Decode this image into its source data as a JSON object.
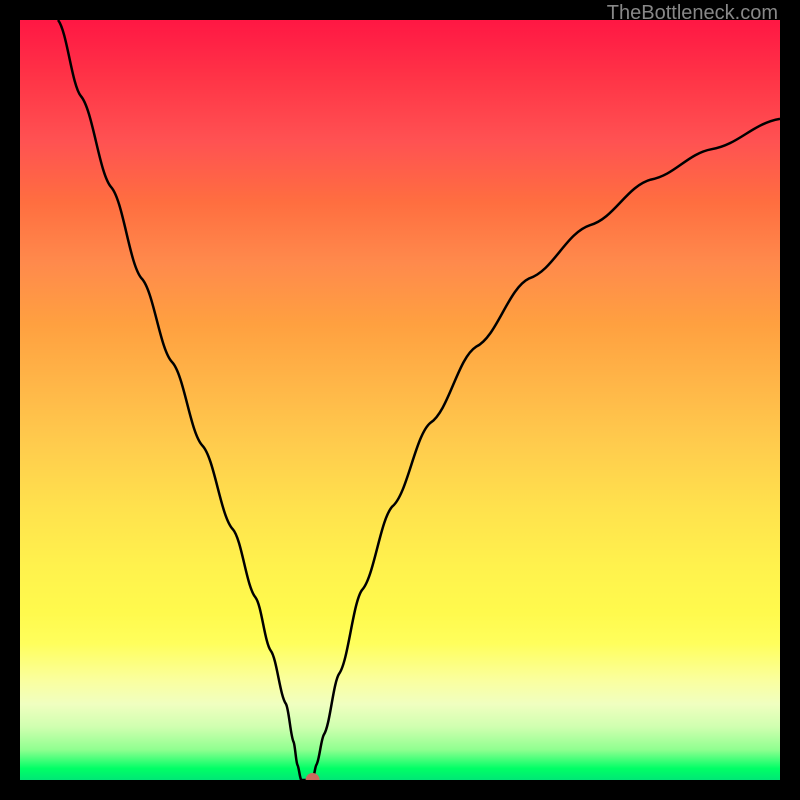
{
  "attribution": "TheBottleneck.com",
  "chart_data": {
    "type": "line",
    "title": "",
    "xlabel": "",
    "ylabel": "",
    "x_range": [
      0,
      100
    ],
    "y_range": [
      0,
      100
    ],
    "grid": false,
    "background": "rainbow-gradient-vertical",
    "gradient_colors": {
      "top": "#ff1744",
      "middle": "#ffeb3b",
      "bottom": "#00e676"
    },
    "series": [
      {
        "name": "bottleneck-curve",
        "color": "#000000",
        "stroke_width": 2.5,
        "points": [
          {
            "x": 5,
            "y": 100
          },
          {
            "x": 8,
            "y": 90
          },
          {
            "x": 12,
            "y": 78
          },
          {
            "x": 16,
            "y": 66
          },
          {
            "x": 20,
            "y": 55
          },
          {
            "x": 24,
            "y": 44
          },
          {
            "x": 28,
            "y": 33
          },
          {
            "x": 31,
            "y": 24
          },
          {
            "x": 33,
            "y": 17
          },
          {
            "x": 35,
            "y": 10
          },
          {
            "x": 36,
            "y": 5
          },
          {
            "x": 36.5,
            "y": 2
          },
          {
            "x": 37,
            "y": 0
          },
          {
            "x": 38.5,
            "y": 0
          },
          {
            "x": 39,
            "y": 2
          },
          {
            "x": 40,
            "y": 6
          },
          {
            "x": 42,
            "y": 14
          },
          {
            "x": 45,
            "y": 25
          },
          {
            "x": 49,
            "y": 36
          },
          {
            "x": 54,
            "y": 47
          },
          {
            "x": 60,
            "y": 57
          },
          {
            "x": 67,
            "y": 66
          },
          {
            "x": 75,
            "y": 73
          },
          {
            "x": 83,
            "y": 79
          },
          {
            "x": 91,
            "y": 83
          },
          {
            "x": 100,
            "y": 87
          }
        ]
      }
    ],
    "marker": {
      "x": 38.5,
      "y": 0,
      "color": "#c96b5e",
      "radius": 7
    }
  }
}
